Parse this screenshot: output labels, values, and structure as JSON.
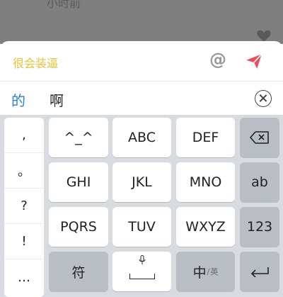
{
  "backdrop": {
    "time_text": "小时前"
  },
  "composer": {
    "draft_text": "很会装逼",
    "at_label": "@"
  },
  "candidates": [
    "的",
    "啊"
  ],
  "punctuation": [
    ",",
    "。",
    "?",
    "!",
    "…"
  ],
  "keys": {
    "row1": [
      "^_^",
      "ABC",
      "DEF"
    ],
    "row2": [
      "GHI",
      "JKL",
      "MNO"
    ],
    "row3": [
      "PQRS",
      "TUV",
      "WXYZ"
    ],
    "ab": "ab",
    "num": "123",
    "fu": "符",
    "zh": "中",
    "zh_sub": "英"
  },
  "colors": {
    "accent_yellow": "#e8c33a",
    "send_red": "#f04a5c",
    "candidate_blue": "#2d7fd8"
  }
}
